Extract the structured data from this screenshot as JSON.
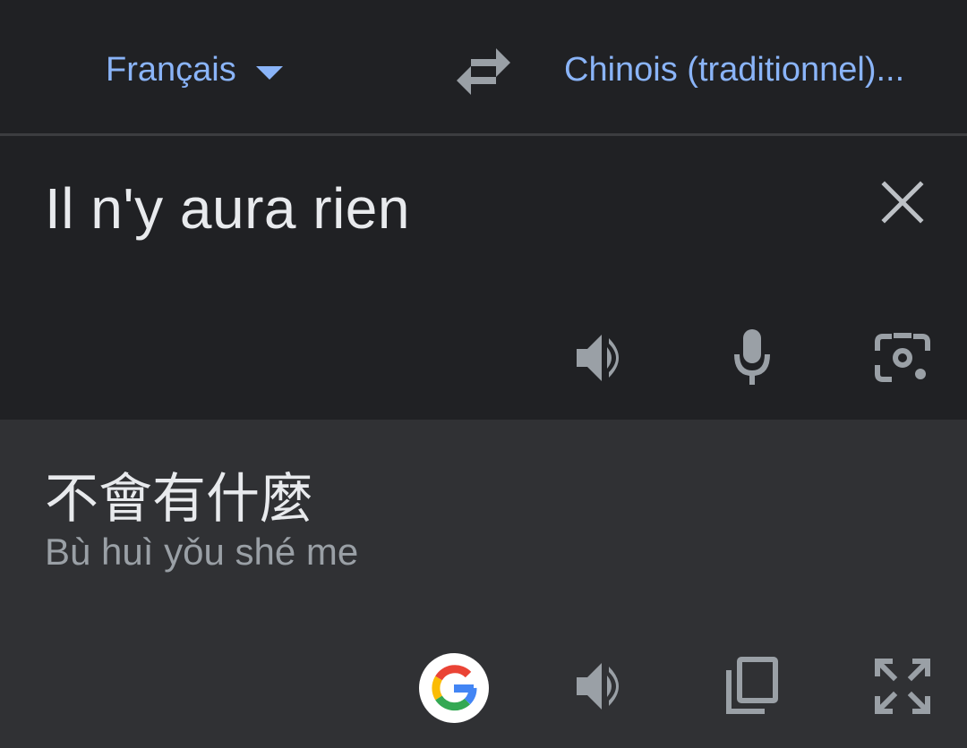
{
  "language_bar": {
    "source_language": "Français",
    "target_language": "Chinois (traditionnel)..."
  },
  "input": {
    "text": "Il n'y aura rien"
  },
  "output": {
    "translation": "不會有什麼",
    "romanization": "Bù huì yǒu shé me"
  },
  "icons": {
    "dropdown": "chevron-down-icon",
    "swap": "swap-icon",
    "clear": "close-icon",
    "speaker": "speaker-icon",
    "microphone": "microphone-icon",
    "camera": "camera-icon",
    "google": "google-icon",
    "copy": "copy-icon",
    "fullscreen": "fullscreen-icon"
  },
  "colors": {
    "accent": "#8ab4f8",
    "background": "#202124",
    "output_background": "#303134",
    "icon": "#9aa0a6",
    "text_primary": "#e8eaed",
    "text_secondary": "#9aa0a6"
  }
}
